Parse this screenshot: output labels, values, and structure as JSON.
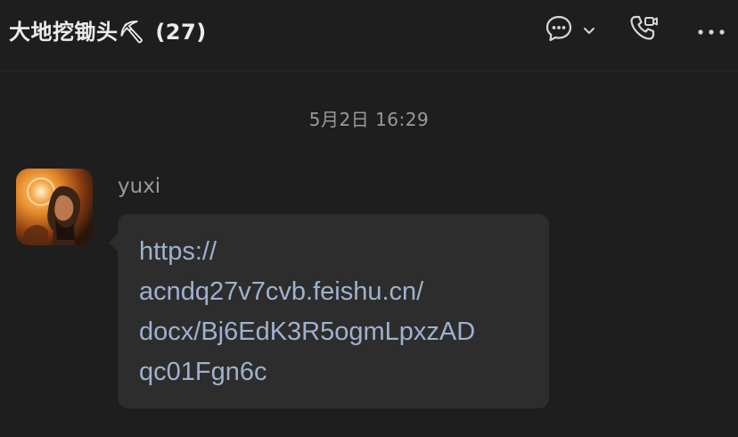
{
  "header": {
    "chat_name": "大地挖锄头",
    "chat_emoji": "⛏",
    "member_count": "(27)",
    "icons": [
      "chat-bubble-icon",
      "chevron-down-icon",
      "call-video-icon",
      "more-icon"
    ]
  },
  "conversation": {
    "date_separator": "5月2日 16:29",
    "messages": [
      {
        "sender": "yuxi",
        "link_lines": [
          "https://",
          "acndq27v7cvb.feishu.cn/",
          "docx/Bj6EdK3R5ogmLpxzAD",
          "qc01Fgn6c"
        ]
      }
    ]
  },
  "colors": {
    "background": "#1e1e1e",
    "bubble": "#2d2d2d",
    "link": "#9fb1cf",
    "muted_text": "#9a9a9a",
    "title_text": "#ececec"
  }
}
